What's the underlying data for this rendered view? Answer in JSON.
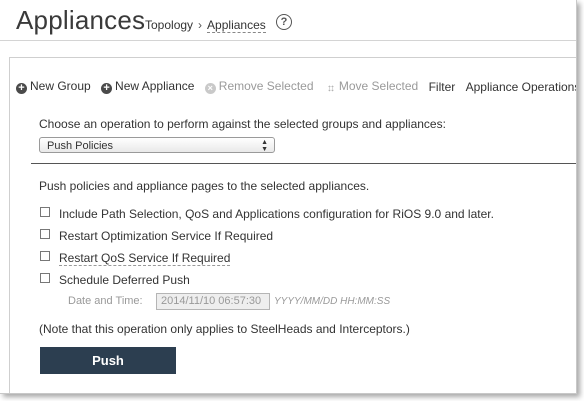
{
  "header": {
    "title": "Appliances",
    "breadcrumb": [
      "Topology",
      "Appliances"
    ],
    "help_label": "?"
  },
  "toolbar": {
    "new_group": "New Group",
    "new_appliance": "New Appliance",
    "remove_selected": "Remove Selected",
    "move_selected": "Move Selected",
    "filter": "Filter",
    "appliance_operations": "Appliance Operations"
  },
  "operations": {
    "choose_label": "Choose an operation to perform against the selected groups and appliances:",
    "selected_operation": "Push Policies",
    "description": "Push policies and appliance pages to the selected appliances.",
    "options": [
      {
        "label": "Include Path Selection, QoS and Applications configuration for RiOS 9.0 and later.",
        "checked": false
      },
      {
        "label": "Restart Optimization Service If Required",
        "checked": false
      },
      {
        "label": "Restart QoS Service If Required",
        "checked": false
      },
      {
        "label": "Schedule Deferred Push",
        "checked": false
      }
    ],
    "date_time_label": "Date and Time:",
    "date_time_value": "2014/11/10 06:57:30",
    "date_time_format": "YYYY/MM/DD HH:MM:SS",
    "note": "(Note that this operation only applies to SteelHeads and Interceptors.)",
    "push_button": "Push"
  },
  "colors": {
    "button_bg": "#2c3e50",
    "text": "#333333",
    "disabled_text": "#9a9a9a"
  },
  "icons": [
    "help-icon",
    "add-icon",
    "remove-icon",
    "move-icon",
    "select-arrows-icon"
  ]
}
